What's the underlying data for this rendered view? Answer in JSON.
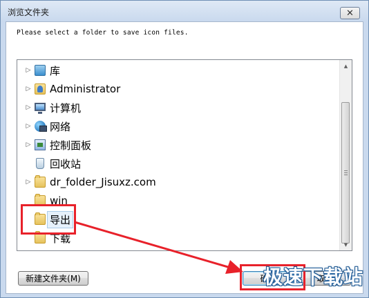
{
  "window": {
    "title": "浏览文件夹",
    "close_glyph": "✕"
  },
  "prompt_text": "Please select a folder to save icon files.",
  "tree": {
    "items": [
      {
        "label": "库",
        "icon": "library-icon",
        "expandable": true
      },
      {
        "label": "Administrator",
        "icon": "user-folder-icon",
        "expandable": true
      },
      {
        "label": "计算机",
        "icon": "computer-icon",
        "expandable": true
      },
      {
        "label": "网络",
        "icon": "network-icon",
        "expandable": true
      },
      {
        "label": "控制面板",
        "icon": "control-panel-icon",
        "expandable": true
      },
      {
        "label": "回收站",
        "icon": "recycle-bin-icon",
        "expandable": false
      },
      {
        "label": "dr_folder_Jisuxz.com",
        "icon": "folder-icon",
        "expandable": true
      },
      {
        "label": "win",
        "icon": "folder-icon",
        "expandable": false
      },
      {
        "label": "导出",
        "icon": "folder-icon",
        "expandable": false,
        "selected": true
      },
      {
        "label": "下载",
        "icon": "folder-icon",
        "expandable": false
      }
    ],
    "expander_glyph": "▷"
  },
  "scrollbar": {
    "up_glyph": "▲",
    "down_glyph": "▼"
  },
  "buttons": {
    "new_folder": "新建文件夹(M)",
    "ok": "确定",
    "cancel": "取消"
  },
  "annotation": {
    "color": "#e8212a"
  },
  "watermark": "极速下载站"
}
